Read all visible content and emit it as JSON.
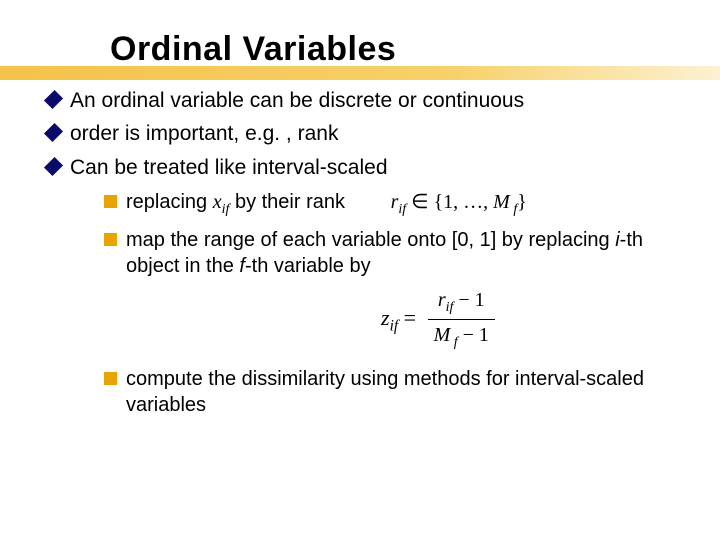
{
  "title": "Ordinal Variables",
  "bullets": {
    "b1": "An ordinal variable can be discrete or continuous",
    "b2": "order is important, e.g. , rank",
    "b3": "Can be treated like interval-scaled",
    "sub1_pre": "replacing ",
    "sub1_var": "x",
    "sub1_sub": "if",
    "sub1_post": "  by their rank",
    "set_r": "r",
    "set_sub": "if",
    "set_in": " ∈ {1, …, ",
    "set_M": "M",
    "set_f": " f",
    "set_close": "}",
    "sub2_a": "map the range of each variable onto [0, 1] by replacing ",
    "sub2_i": "i",
    "sub2_b": "-th object in the ",
    "sub2_f": "f",
    "sub2_c": "-th variable by",
    "eq_lhs_z": "z",
    "eq_lhs_sub": "if",
    "eq_equals": " = ",
    "eq_num_r": "r",
    "eq_num_sub": "if",
    "eq_num_tail": " − 1",
    "eq_den_M": "M",
    "eq_den_sub": " f",
    "eq_den_tail": " − 1",
    "sub3": "compute the dissimilarity using methods for interval-scaled variables"
  }
}
